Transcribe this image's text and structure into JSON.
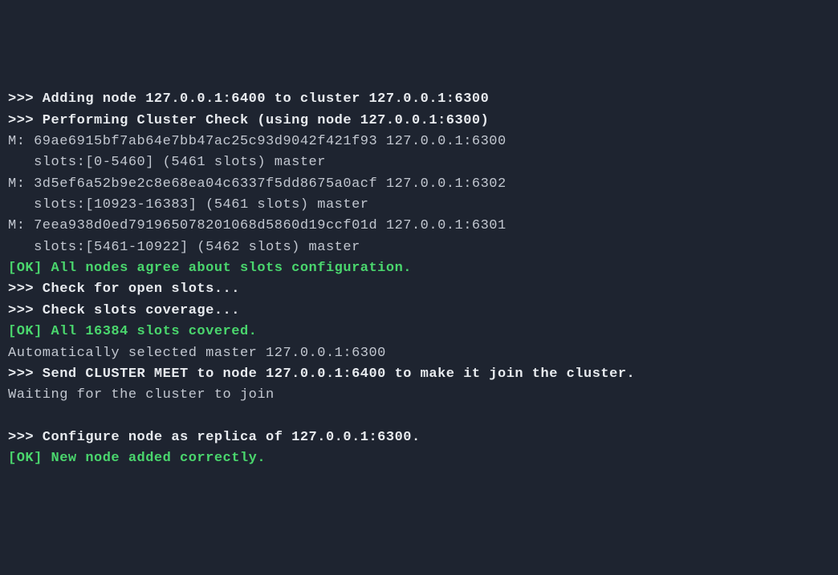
{
  "terminal": {
    "lines": [
      {
        "class": "bold-white",
        "text": ">>> Adding node 127.0.0.1:6400 to cluster 127.0.0.1:6300"
      },
      {
        "class": "bold-white",
        "text": ">>> Performing Cluster Check (using node 127.0.0.1:6300)"
      },
      {
        "class": "normal",
        "text": "M: 69ae6915bf7ab64e7bb47ac25c93d9042f421f93 127.0.0.1:6300"
      },
      {
        "class": "normal",
        "text": "   slots:[0-5460] (5461 slots) master"
      },
      {
        "class": "normal",
        "text": "M: 3d5ef6a52b9e2c8e68ea04c6337f5dd8675a0acf 127.0.0.1:6302"
      },
      {
        "class": "normal",
        "text": "   slots:[10923-16383] (5461 slots) master"
      },
      {
        "class": "normal",
        "text": "M: 7eea938d0ed791965078201068d5860d19ccf01d 127.0.0.1:6301"
      },
      {
        "class": "normal",
        "text": "   slots:[5461-10922] (5462 slots) master"
      },
      {
        "class": "ok-green",
        "text": "[OK] All nodes agree about slots configuration."
      },
      {
        "class": "bold-white",
        "text": ">>> Check for open slots..."
      },
      {
        "class": "bold-white",
        "text": ">>> Check slots coverage..."
      },
      {
        "class": "ok-green",
        "text": "[OK] All 16384 slots covered."
      },
      {
        "class": "normal",
        "text": "Automatically selected master 127.0.0.1:6300"
      },
      {
        "class": "bold-white",
        "text": ">>> Send CLUSTER MEET to node 127.0.0.1:6400 to make it join the cluster."
      },
      {
        "class": "normal",
        "text": "Waiting for the cluster to join"
      },
      {
        "class": "normal",
        "text": ""
      },
      {
        "class": "bold-white",
        "text": ">>> Configure node as replica of 127.0.0.1:6300."
      },
      {
        "class": "ok-green",
        "text": "[OK] New node added correctly."
      }
    ]
  }
}
